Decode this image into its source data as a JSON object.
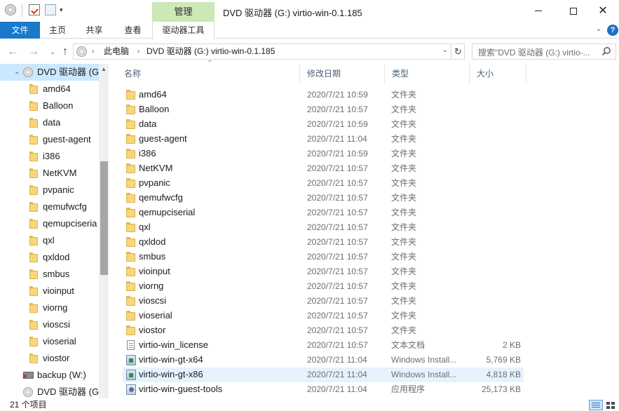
{
  "window": {
    "title": "DVD 驱动器 (G:) virtio-win-0.1.185",
    "contextual_tab": "管理",
    "quick_access_dropdown": "▾"
  },
  "ribbon": {
    "tabs": [
      {
        "label": "文件"
      },
      {
        "label": "主页"
      },
      {
        "label": "共享"
      },
      {
        "label": "查看"
      },
      {
        "label": "驱动器工具"
      }
    ],
    "expand_glyph": "⌄",
    "help_glyph": "?"
  },
  "address_bar": {
    "segments": [
      "此电脑",
      "DVD 驱动器 (G:) virtio-win-0.1.185"
    ],
    "chevron": "›",
    "dropdown": "⌄",
    "refresh_glyph": "↻",
    "search_placeholder": "搜索\"DVD 驱动器 (G:) virtio-..."
  },
  "navigation_pane": {
    "items": [
      {
        "label": "DVD 驱动器 (G:",
        "kind": "drive",
        "selected": true
      },
      {
        "label": "amd64",
        "kind": "folder"
      },
      {
        "label": "Balloon",
        "kind": "folder"
      },
      {
        "label": "data",
        "kind": "folder"
      },
      {
        "label": "guest-agent",
        "kind": "folder"
      },
      {
        "label": "i386",
        "kind": "folder"
      },
      {
        "label": "NetKVM",
        "kind": "folder"
      },
      {
        "label": "pvpanic",
        "kind": "folder"
      },
      {
        "label": "qemufwcfg",
        "kind": "folder"
      },
      {
        "label": "qemupciseria",
        "kind": "folder"
      },
      {
        "label": "qxl",
        "kind": "folder"
      },
      {
        "label": "qxldod",
        "kind": "folder"
      },
      {
        "label": "smbus",
        "kind": "folder"
      },
      {
        "label": "vioinput",
        "kind": "folder"
      },
      {
        "label": "viorng",
        "kind": "folder"
      },
      {
        "label": "vioscsi",
        "kind": "folder"
      },
      {
        "label": "vioserial",
        "kind": "folder"
      },
      {
        "label": "viostor",
        "kind": "folder"
      },
      {
        "label": "backup (W:)",
        "kind": "network-drive"
      },
      {
        "label": "DVD 驱动器 (G:)",
        "kind": "drive"
      }
    ]
  },
  "file_list": {
    "columns": {
      "name": "名称",
      "date": "修改日期",
      "type": "类型",
      "size": "大小"
    },
    "sort_indicator": "⌃",
    "rows": [
      {
        "name": "amd64",
        "date": "2020/7/21 10:59",
        "type": "文件夹",
        "size": "",
        "icon": "folder"
      },
      {
        "name": "Balloon",
        "date": "2020/7/21 10:57",
        "type": "文件夹",
        "size": "",
        "icon": "folder"
      },
      {
        "name": "data",
        "date": "2020/7/21 10:59",
        "type": "文件夹",
        "size": "",
        "icon": "folder"
      },
      {
        "name": "guest-agent",
        "date": "2020/7/21 11:04",
        "type": "文件夹",
        "size": "",
        "icon": "folder"
      },
      {
        "name": "i386",
        "date": "2020/7/21 10:59",
        "type": "文件夹",
        "size": "",
        "icon": "folder"
      },
      {
        "name": "NetKVM",
        "date": "2020/7/21 10:57",
        "type": "文件夹",
        "size": "",
        "icon": "folder"
      },
      {
        "name": "pvpanic",
        "date": "2020/7/21 10:57",
        "type": "文件夹",
        "size": "",
        "icon": "folder"
      },
      {
        "name": "qemufwcfg",
        "date": "2020/7/21 10:57",
        "type": "文件夹",
        "size": "",
        "icon": "folder"
      },
      {
        "name": "qemupciserial",
        "date": "2020/7/21 10:57",
        "type": "文件夹",
        "size": "",
        "icon": "folder"
      },
      {
        "name": "qxl",
        "date": "2020/7/21 10:57",
        "type": "文件夹",
        "size": "",
        "icon": "folder"
      },
      {
        "name": "qxldod",
        "date": "2020/7/21 10:57",
        "type": "文件夹",
        "size": "",
        "icon": "folder"
      },
      {
        "name": "smbus",
        "date": "2020/7/21 10:57",
        "type": "文件夹",
        "size": "",
        "icon": "folder"
      },
      {
        "name": "vioinput",
        "date": "2020/7/21 10:57",
        "type": "文件夹",
        "size": "",
        "icon": "folder"
      },
      {
        "name": "viorng",
        "date": "2020/7/21 10:57",
        "type": "文件夹",
        "size": "",
        "icon": "folder"
      },
      {
        "name": "vioscsi",
        "date": "2020/7/21 10:57",
        "type": "文件夹",
        "size": "",
        "icon": "folder"
      },
      {
        "name": "vioserial",
        "date": "2020/7/21 10:57",
        "type": "文件夹",
        "size": "",
        "icon": "folder"
      },
      {
        "name": "viostor",
        "date": "2020/7/21 10:57",
        "type": "文件夹",
        "size": "",
        "icon": "folder"
      },
      {
        "name": "virtio-win_license",
        "date": "2020/7/21 10:57",
        "type": "文本文档",
        "size": "2 KB",
        "icon": "text-document"
      },
      {
        "name": "virtio-win-gt-x64",
        "date": "2020/7/21 11:04",
        "type": "Windows Install...",
        "size": "5,769 KB",
        "icon": "installer"
      },
      {
        "name": "virtio-win-gt-x86",
        "date": "2020/7/21 11:04",
        "type": "Windows Install...",
        "size": "4,818 KB",
        "icon": "installer",
        "hover": true
      },
      {
        "name": "virtio-win-guest-tools",
        "date": "2020/7/21 11:04",
        "type": "应用程序",
        "size": "25,173 KB",
        "icon": "application"
      }
    ]
  },
  "status_bar": {
    "item_count": "21 个项目"
  },
  "colors": {
    "file_tab": "#1979ca",
    "context_tab": "#cde7b7",
    "selection": "#cce8ff",
    "hover": "#e5f3ff",
    "folder": "#f8d77a"
  }
}
